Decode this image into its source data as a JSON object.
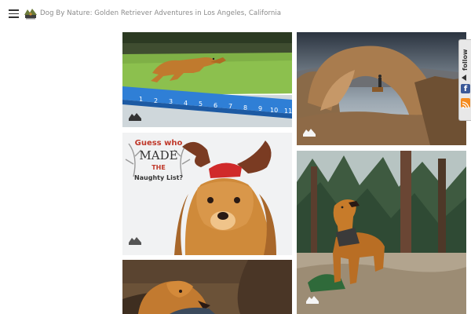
{
  "header": {
    "menu_icon": "hamburger-menu-icon",
    "logo_icon": "dog-by-nature-logo-icon",
    "site_title": "Dog By Nature: Golden Retriever Adventures in Los Angeles, California"
  },
  "gallery": {
    "photos": [
      {
        "subject": "golden retriever leaping over grass above a dock-diving distance scale"
      },
      {
        "subject": "person standing under a natural rock arch at dusk"
      },
      {
        "subject": "golden retriever wearing reindeer antlers holiday card"
      },
      {
        "subject": "golden retriever standing in a pine forest with a backpack"
      },
      {
        "subject": "golden retriever lying on a brown couch"
      }
    ],
    "scale_numbers": [
      "1",
      "2",
      "3",
      "4",
      "5",
      "6",
      "7",
      "8",
      "9",
      "10",
      "11"
    ],
    "card": {
      "line1": "Guess who",
      "line2": "MADE",
      "line3": "THE",
      "line4": "Naughty List?"
    }
  },
  "follow_widget": {
    "label": "follow",
    "icons": [
      "facebook-icon",
      "rss-icon"
    ],
    "facebook_glyph": "f"
  },
  "colors": {
    "title": "#8a8a8a",
    "facebook": "#3b5998",
    "rss": "#f48b1f",
    "scale_blue": "#2f7fd6"
  }
}
